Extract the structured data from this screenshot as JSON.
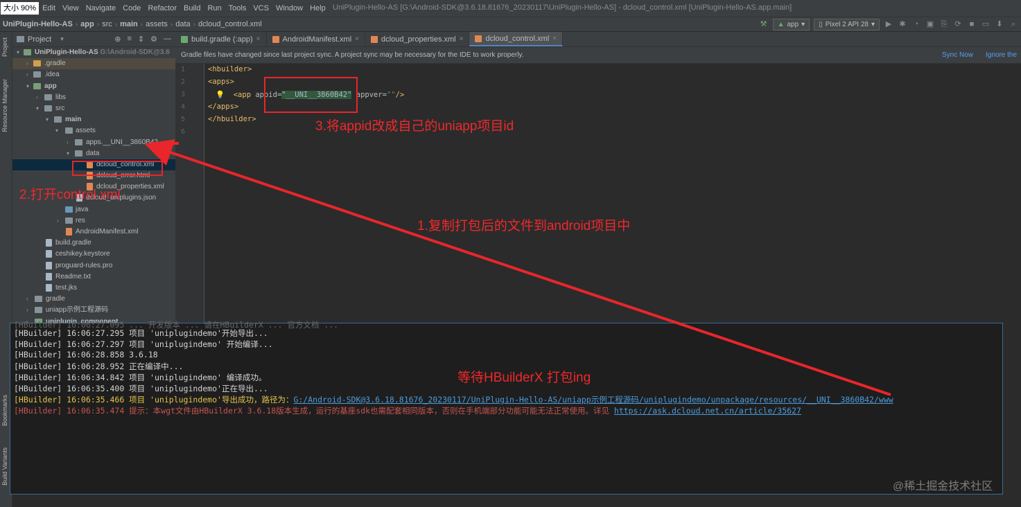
{
  "menubar": {
    "zoom_badge": "大小 90%",
    "items": [
      "Edit",
      "View",
      "Navigate",
      "Code",
      "Refactor",
      "Build",
      "Run",
      "Tools",
      "VCS",
      "Window",
      "Help"
    ],
    "window_title": "UniPlugin-Hello-AS [G:\\Android-SDK@3.6.18.81676_20230117\\UniPlugin-Hello-AS] - dcloud_control.xml [UniPlugin-Hello-AS.app.main]"
  },
  "navbar": {
    "crumbs": [
      "UniPlugin-Hello-AS",
      "app",
      "src",
      "main",
      "assets",
      "data",
      "dcloud_control.xml"
    ],
    "run_config": "app",
    "device": "Pixel 2 API 28"
  },
  "sidebar": {
    "project_label": "Project",
    "resource_manager_label": "Resource Manager",
    "bookmarks_label": "Bookmarks",
    "build_variants_label": "Build Variants"
  },
  "project_panel": {
    "title": "Project",
    "root_name": "UniPlugin-Hello-AS",
    "root_path": "G:\\Android-SDK@3.6",
    "items": [
      {
        "label": ".gradle"
      },
      {
        "label": ".idea"
      },
      {
        "label": "app"
      },
      {
        "label": "libs"
      },
      {
        "label": "src"
      },
      {
        "label": "main"
      },
      {
        "label": "assets"
      },
      {
        "label": "apps.__UNI__3860B42"
      },
      {
        "label": "data"
      },
      {
        "label": "dcloud_control.xml"
      },
      {
        "label": "dcloud_error.html"
      },
      {
        "label": "dcloud_properties.xml"
      },
      {
        "label": "dcloud_uniplugins.json"
      },
      {
        "label": "java"
      },
      {
        "label": "res"
      },
      {
        "label": "AndroidManifest.xml"
      },
      {
        "label": "build.gradle"
      },
      {
        "label": "ceshikey.keystore"
      },
      {
        "label": "proguard-rules.pro"
      },
      {
        "label": "Readme.txt"
      },
      {
        "label": "test.jks"
      },
      {
        "label": "gradle"
      },
      {
        "label": "uniapp示例工程源码"
      },
      {
        "label": "uniplugin_component"
      }
    ]
  },
  "tabs": [
    {
      "label": "build.gradle (:app)"
    },
    {
      "label": "AndroidManifest.xml"
    },
    {
      "label": "dcloud_properties.xml"
    },
    {
      "label": "dcloud_control.xml"
    }
  ],
  "notification": {
    "text": "Gradle files have changed since last project sync. A project sync may be necessary for the IDE to work properly.",
    "sync_now": "Sync Now",
    "ignore": "Ignore the"
  },
  "editor": {
    "line_numbers": [
      "1",
      "2",
      "3",
      "4",
      "5",
      "6"
    ],
    "lines": {
      "l1": "<hbuilder>",
      "l2": "<apps>",
      "l3_open": "<app ",
      "l3_attr1": "appid=",
      "l3_val1": "\"__UNI__3860B42\"",
      "l3_attr2": " appver=",
      "l3_val2": "\"\"",
      "l3_close": "/>",
      "l4": "</apps>",
      "l5": "</hbuilder>"
    }
  },
  "console": {
    "partial_top": "[HBuilder] 16:06:27.095 ... 开发版本 ... 请在HBuilderX ... 官方文档 ...",
    "lines": [
      "[HBuilder] 16:06:27.295 项目 'uniplugindemo'开始导出...",
      "[HBuilder] 16:06:27.297 项目 'uniplugindemo' 开始编译...",
      "[HBuilder] 16:06:28.858 3.6.18",
      "[HBuilder] 16:06:28.952 正在编译中...",
      "[HBuilder] 16:06:34.842 项目 'uniplugindemo' 编译成功。",
      "[HBuilder] 16:06:35.400 项目 'uniplugindemo'正在导出..."
    ],
    "export_line": "[HBuilder] 16:06:35.466 项目 'uniplugindemo'导出成功，路径为：",
    "export_path": "G:/Android-SDK@3.6.18.81676_20230117/UniPlugin-Hello-AS/uniapp示例工程源码/uniplugindemo/unpackage/resources/__UNI__3860B42/www",
    "warn_line": "[HBuilder] 16:06:35.474 提示：本wgt文件由HBuilderX 3.6.18版本生成，运行的基座sdk也需配套相同版本，否则在手机端部分功能可能无法正常使用。详见 ",
    "warn_link": "https://ask.dcloud.net.cn/article/35627"
  },
  "annotations": {
    "step1": "1.复制打包后的文件到android项目中",
    "step2": "2.打开control.xml",
    "step3": "3.将appid改成自己的uniapp项目id",
    "waiting": "等待HBuilderX 打包ing"
  },
  "watermark": "@稀土掘金技术社区",
  "colors": {
    "annotation_red": "#e8262b",
    "link_blue": "#589df6",
    "xml_tag": "#e8bf6a",
    "xml_value": "#6a8759"
  }
}
